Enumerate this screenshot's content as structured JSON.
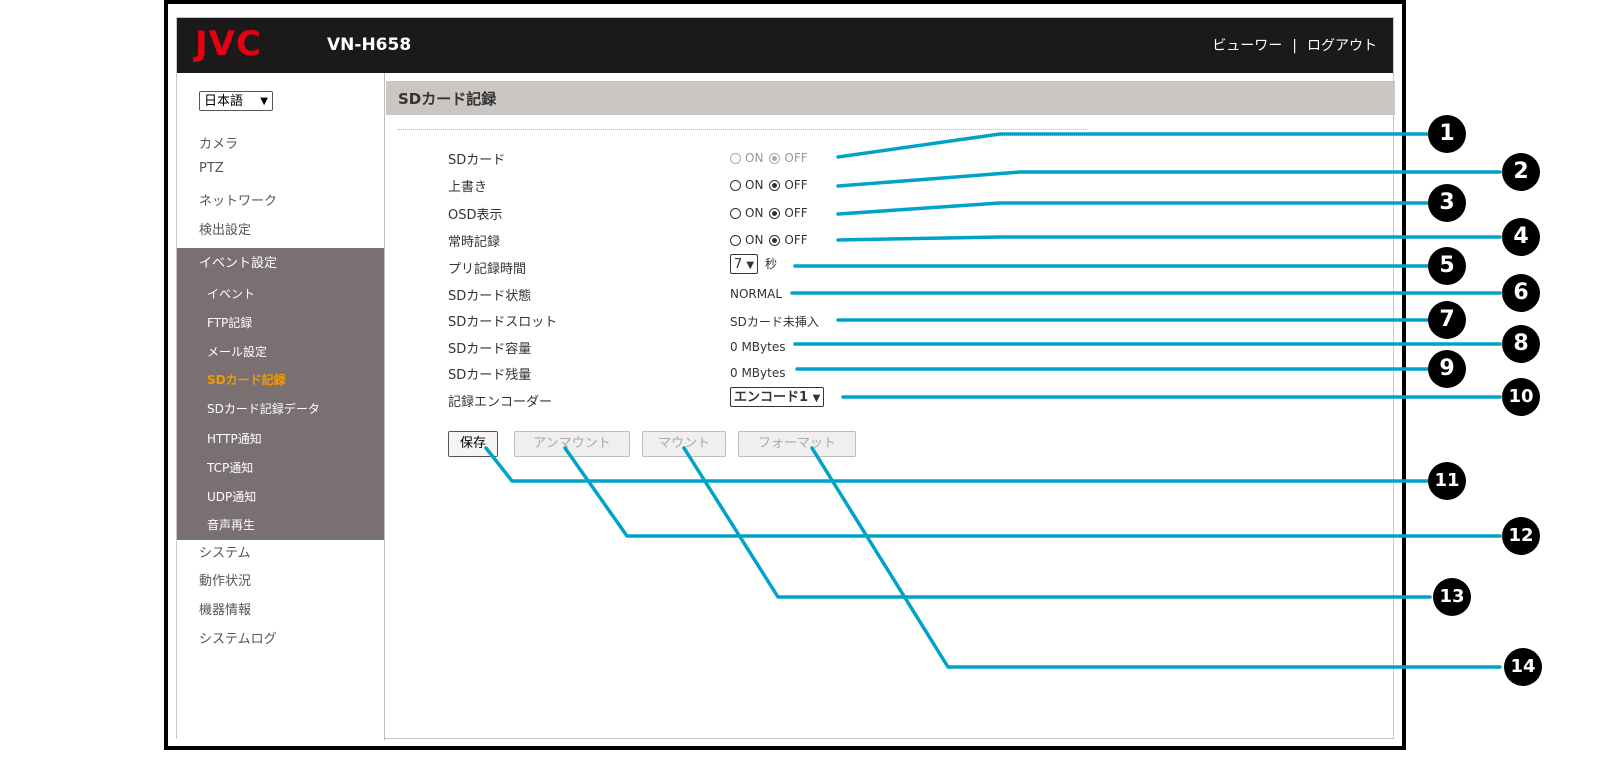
{
  "header": {
    "logo": "JVC",
    "model": "VN-H658",
    "viewer_link": "ビューワー",
    "separator": "|",
    "logout_link": "ログアウト"
  },
  "sidebar": {
    "language": "日本語",
    "items_top": [
      "カメラ",
      "PTZ",
      "ネットワーク",
      "検出設定"
    ],
    "event_group": {
      "label": "イベント設定",
      "items": [
        "イベント",
        "FTP記録",
        "メール設定",
        "SDカード記録",
        "SDカード記録データ",
        "HTTP通知",
        "TCP通知",
        "UDP通知",
        "音声再生"
      ],
      "active_index": 3
    },
    "items_bottom": [
      "システム",
      "動作状況",
      "機器情報",
      "システムログ"
    ]
  },
  "page": {
    "title": "SDカード記録",
    "on_label": "ON",
    "off_label": "OFF",
    "rows": {
      "sd_card": {
        "label": "SDカード",
        "value": "OFF"
      },
      "overwrite": {
        "label": "上書き",
        "value": "OFF"
      },
      "osd": {
        "label": "OSD表示",
        "value": "OFF"
      },
      "continuous": {
        "label": "常時記録",
        "value": "OFF"
      },
      "pre_record": {
        "label": "プリ記録時間",
        "value": "7",
        "unit": "秒"
      },
      "status": {
        "label": "SDカード状態",
        "value": "NORMAL"
      },
      "slot": {
        "label": "SDカードスロット",
        "value": "SDカード未挿入"
      },
      "capacity": {
        "label": "SDカード容量",
        "value": "0 MBytes"
      },
      "remaining": {
        "label": "SDカード残量",
        "value": "0 MBytes"
      },
      "encoder": {
        "label": "記録エンコーダー",
        "value": "エンコード1"
      }
    },
    "buttons": {
      "save": "保存",
      "unmount": "アンマウント",
      "mount": "マウント",
      "format": "フォーマット"
    }
  },
  "callouts": {
    "color": "#00a3c8",
    "numbers": [
      "1",
      "2",
      "3",
      "4",
      "5",
      "6",
      "7",
      "8",
      "9",
      "10",
      "11",
      "12",
      "13",
      "14"
    ]
  }
}
